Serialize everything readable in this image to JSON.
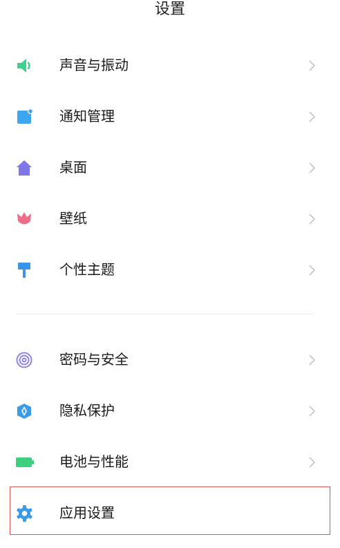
{
  "title": "设置",
  "items": [
    {
      "label": "声音与振动",
      "icon": "speaker-icon",
      "color": "#3fcf8e"
    },
    {
      "label": "通知管理",
      "icon": "notification-icon",
      "color": "#3ea6ee"
    },
    {
      "label": "桌面",
      "icon": "home-icon",
      "color": "#7d78e6"
    },
    {
      "label": "壁纸",
      "icon": "tulip-icon",
      "color": "#ee6d88"
    },
    {
      "label": "个性主题",
      "icon": "paint-roller-icon",
      "color": "#3a94e8"
    },
    {
      "label": "密码与安全",
      "icon": "fingerprint-icon",
      "color": "#8e84e4"
    },
    {
      "label": "隐私保护",
      "icon": "privacy-shield-icon",
      "color": "#3a9be6"
    },
    {
      "label": "电池与性能",
      "icon": "battery-icon",
      "color": "#3dd17f"
    },
    {
      "label": "应用设置",
      "icon": "gear-icon",
      "color": "#3a9be6"
    }
  ],
  "highlight_color": "#d9534f"
}
